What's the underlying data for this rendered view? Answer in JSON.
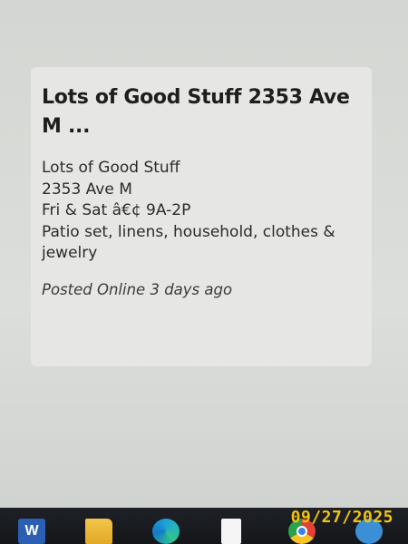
{
  "listing": {
    "title": "Lots of Good Stuff 2353 Ave M ...",
    "body_lines": [
      "Lots of Good Stuff",
      "2353 Ave M",
      "Fri & Sat â€¢ 9A-2P",
      "Patio set, linens, household, clothes & jewelry"
    ],
    "posted": "Posted Online 3 days ago"
  },
  "taskbar": {
    "icons": [
      "word-icon",
      "folder-icon",
      "edge-icon",
      "document-icon",
      "chrome-icon",
      "app-icon"
    ],
    "word_letter": "W"
  },
  "photo_date_stamp": "09/27/2025",
  "colors": {
    "screen": "#d9dbd8",
    "card": "#e6e7e4",
    "text": "#1d1f1e",
    "taskbar": "#1a1c20",
    "date_stamp": "#f1c40f"
  }
}
